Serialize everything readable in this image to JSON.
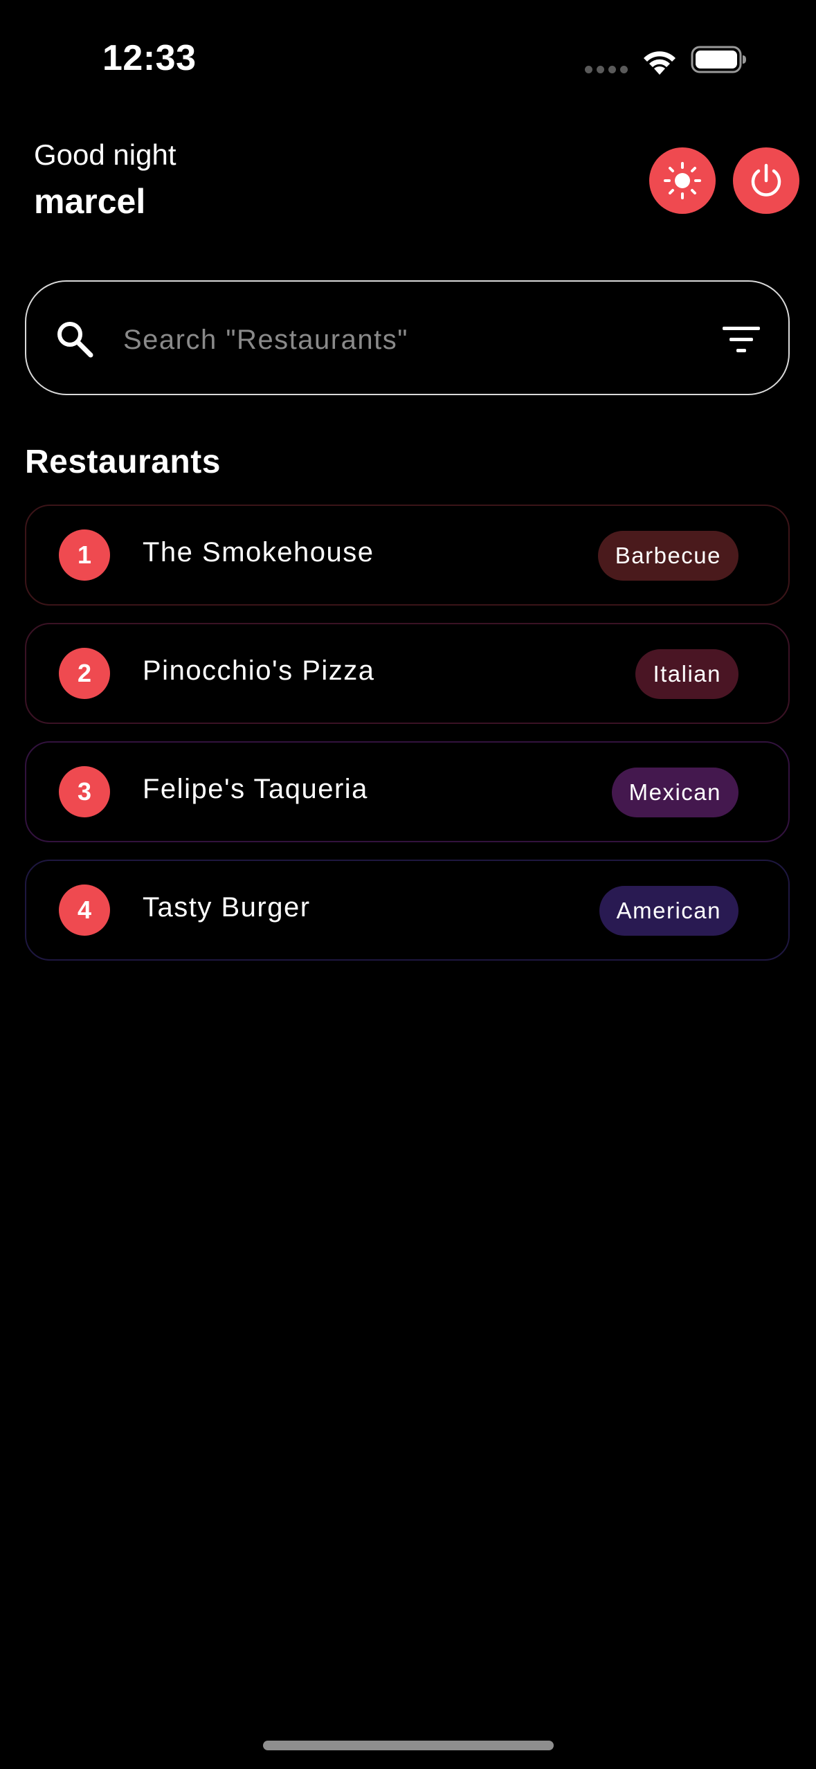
{
  "status_bar": {
    "time": "12:33"
  },
  "header": {
    "greeting": "Good night",
    "username": "marcel",
    "theme_toggle_icon": "sun-icon",
    "power_icon": "power-icon"
  },
  "search": {
    "placeholder": "Search \"Restaurants\"",
    "value": ""
  },
  "section": {
    "title": "Restaurants"
  },
  "restaurants": [
    {
      "rank": "1",
      "name": "The Smokehouse",
      "cuisine": "Barbecue",
      "tag_color": "#4a1a1c",
      "border_color": "#3b1418"
    },
    {
      "rank": "2",
      "name": "Pinocchio's Pizza",
      "cuisine": "Italian",
      "tag_color": "#4a1524",
      "border_color": "#3a1224"
    },
    {
      "rank": "3",
      "name": "Felipe's Taqueria",
      "cuisine": "Mexican",
      "tag_color": "#44184e",
      "border_color": "#32123e"
    },
    {
      "rank": "4",
      "name": "Tasty Burger",
      "cuisine": "American",
      "tag_color": "#291a52",
      "border_color": "#1e1740"
    }
  ],
  "colors": {
    "accent": "#ef4a50",
    "background": "#000000"
  }
}
